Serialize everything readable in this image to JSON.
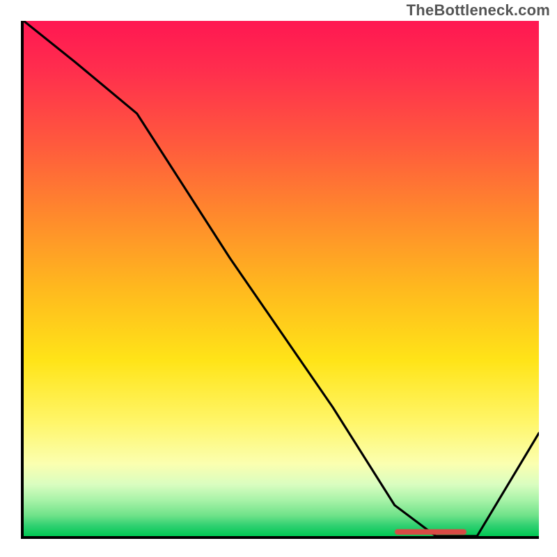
{
  "watermark": "TheBottleneck.com",
  "colors": {
    "axis": "#000000",
    "curve": "#000000",
    "blob": "#d94a45",
    "watermark_text": "#555555"
  },
  "chart_data": {
    "type": "line",
    "title": "",
    "xlabel": "",
    "ylabel": "",
    "xlim": [
      0,
      100
    ],
    "ylim": [
      0,
      100
    ],
    "grid": false,
    "legend": false,
    "background_gradient": {
      "direction": "top-to-bottom",
      "stops": [
        {
          "pos": 0,
          "color": "#ff1752"
        },
        {
          "pos": 24,
          "color": "#ff5a3d"
        },
        {
          "pos": 52,
          "color": "#ffb91e"
        },
        {
          "pos": 78,
          "color": "#fff66a"
        },
        {
          "pos": 93,
          "color": "#a8f3a8"
        },
        {
          "pos": 100,
          "color": "#00c853"
        }
      ]
    },
    "series": [
      {
        "name": "bottleneck-curve",
        "x": [
          0,
          10,
          22,
          40,
          60,
          72,
          80,
          88,
          100
        ],
        "y": [
          100,
          92,
          82,
          54,
          25,
          6,
          0,
          0,
          20
        ]
      }
    ],
    "annotations": [
      {
        "name": "optimal-range-marker",
        "kind": "segment",
        "x_start": 72,
        "x_end": 86,
        "y": 0,
        "color": "#d94a45"
      }
    ]
  }
}
